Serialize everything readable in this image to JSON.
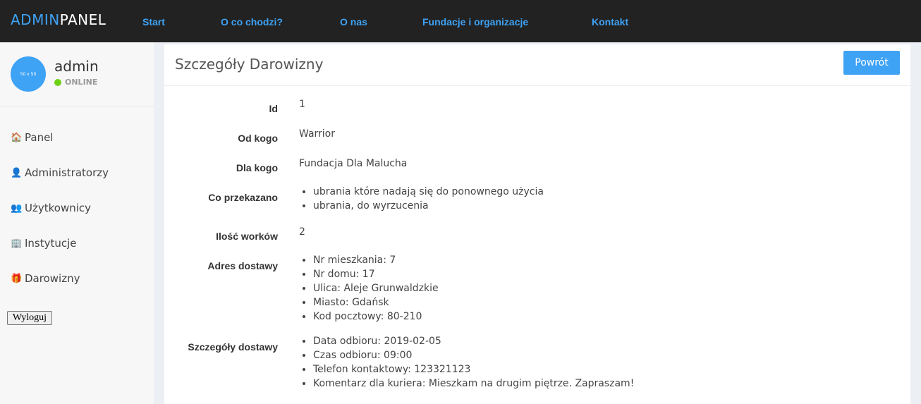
{
  "brand": {
    "part1": "ADMIN",
    "part2": "PANEL"
  },
  "nav": [
    "Start",
    "O co chodzi?",
    "O nas",
    "Fundacje i organizacje",
    "Kontakt"
  ],
  "user": {
    "avatar_text": "50 x 50",
    "name": "admin",
    "status": "ONLINE"
  },
  "sidebar": [
    {
      "label": "Panel",
      "icon": "home-icon",
      "glyph": "🏠"
    },
    {
      "label": "Administratorzy",
      "icon": "user-icon",
      "glyph": "👤"
    },
    {
      "label": "Użytkownicy",
      "icon": "users-icon",
      "glyph": "👥"
    },
    {
      "label": "Instytucje",
      "icon": "building-icon",
      "glyph": "🏢"
    },
    {
      "label": "Darowizny",
      "icon": "gift-icon",
      "glyph": "🎁"
    }
  ],
  "logout_label": "Wyloguj",
  "card": {
    "title": "Szczegóły Darowizny",
    "back_label": "Powrót"
  },
  "details": {
    "id": {
      "label": "Id",
      "value": "1"
    },
    "from": {
      "label": "Od kogo",
      "value": "Warrior"
    },
    "to": {
      "label": "Dla kogo",
      "value": "Fundacja Dla Malucha"
    },
    "items": {
      "label": "Co przekazano",
      "list": [
        "ubrania które nadają się do ponownego użycia",
        "ubrania, do wyrzucenia"
      ]
    },
    "bags": {
      "label": "Ilość worków",
      "value": "2"
    },
    "address": {
      "label": "Adres dostawy",
      "list": [
        "Nr mieszkania: 7",
        "Nr domu: 17",
        "Ulica: Aleje Grunwaldzkie",
        "Miasto: Gdańsk",
        "Kod pocztowy: 80-210"
      ]
    },
    "delivery": {
      "label": "Szczegóły dostawy",
      "list": [
        "Data odbioru: 2019-02-05",
        "Czas odbioru: 09:00",
        "Telefon kontaktowy: 123321123",
        "Komentarz dla kuriera: Mieszkam na drugim piętrze. Zapraszam!"
      ]
    }
  }
}
